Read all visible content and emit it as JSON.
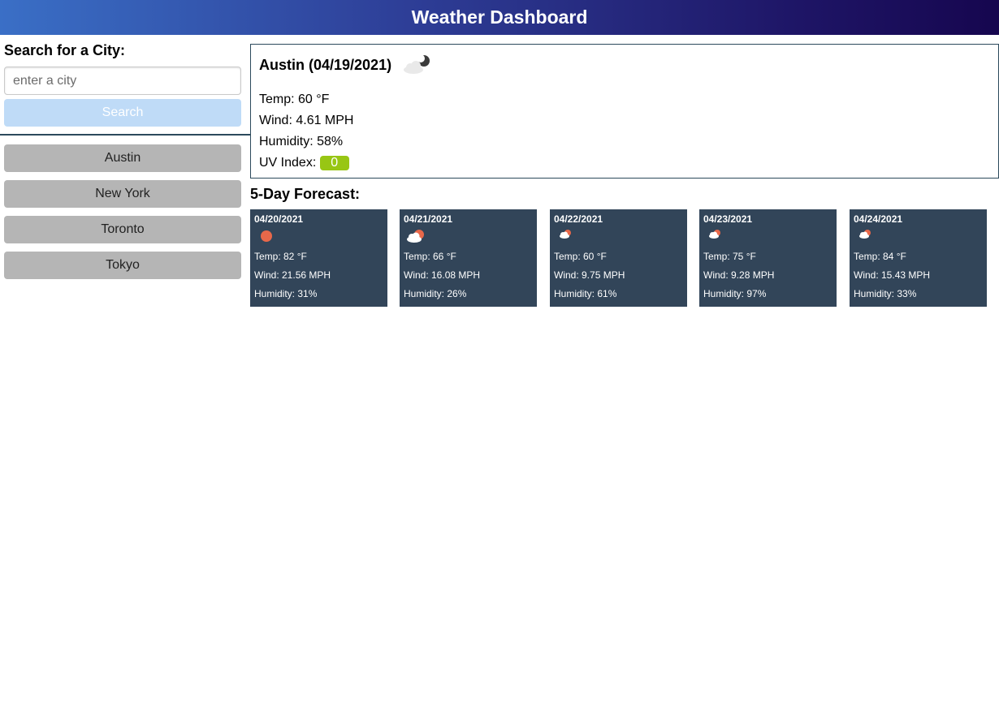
{
  "header": {
    "title": "Weather Dashboard"
  },
  "sidebar": {
    "search_title": "Search for a City:",
    "input_placeholder": "enter a city",
    "input_value": "",
    "search_label": "Search",
    "history": [
      "Austin",
      "New York",
      "Toronto",
      "Tokyo"
    ]
  },
  "current": {
    "title": "Austin (04/19/2021)",
    "icon": "night-cloud-icon",
    "temp": "Temp: 60 °F",
    "wind": "Wind: 4.61 MPH",
    "humidity": "Humidity: 58%",
    "uv_label": "UV Index:",
    "uv_value": "0",
    "uv_color": "#98c614"
  },
  "forecast": {
    "title": "5-Day Forecast:",
    "days": [
      {
        "date": "04/20/2021",
        "icon": "sun-icon",
        "temp": "Temp: 82 °F",
        "wind": "Wind: 21.56 MPH",
        "humidity": "Humidity: 31%"
      },
      {
        "date": "04/21/2021",
        "icon": "partly-cloudy-icon",
        "temp": "Temp: 66 °F",
        "wind": "Wind: 16.08 MPH",
        "humidity": "Humidity: 26%"
      },
      {
        "date": "04/22/2021",
        "icon": "partly-cloudy-icon",
        "temp": "Temp: 60 °F",
        "wind": "Wind: 9.75 MPH",
        "humidity": "Humidity: 61%"
      },
      {
        "date": "04/23/2021",
        "icon": "partly-cloudy-icon",
        "temp": "Temp: 75 °F",
        "wind": "Wind: 9.28 MPH",
        "humidity": "Humidity: 97%"
      },
      {
        "date": "04/24/2021",
        "icon": "partly-cloudy-icon",
        "temp": "Temp: 84 °F",
        "wind": "Wind: 15.43 MPH",
        "humidity": "Humidity: 33%"
      }
    ]
  }
}
